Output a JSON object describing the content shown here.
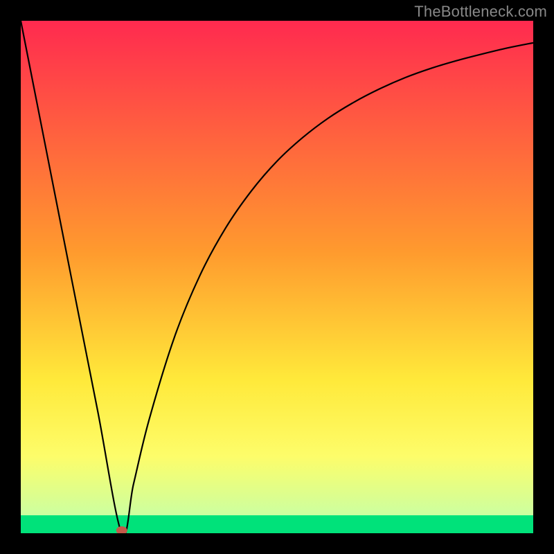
{
  "watermark": "TheBottleneck.com",
  "chart_data": {
    "type": "line",
    "title": "",
    "xlabel": "",
    "ylabel": "",
    "xlim": [
      0,
      100
    ],
    "ylim": [
      0,
      100
    ],
    "grid": false,
    "series": [
      {
        "name": "curve",
        "x": [
          0,
          5,
          10,
          15,
          19.7,
          22,
          25,
          30,
          35,
          40,
          45,
          50,
          55,
          60,
          65,
          70,
          75,
          80,
          85,
          90,
          95,
          100
        ],
        "y": [
          100,
          74.6,
          49.2,
          23.9,
          0,
          9.6,
          22.0,
          38.3,
          50.4,
          59.6,
          66.8,
          72.6,
          77.2,
          81.0,
          84.1,
          86.7,
          88.9,
          90.7,
          92.2,
          93.5,
          94.7,
          95.7
        ]
      }
    ],
    "bottom_band": {
      "from_y": 0,
      "to_y": 3.5,
      "color": "#00e27a"
    },
    "marker": {
      "x": 19.7,
      "y": 0,
      "color": "#c55a4a"
    },
    "gradient_stops": [
      {
        "offset": 0,
        "color": "#ff2a4f"
      },
      {
        "offset": 45,
        "color": "#ff9a2e"
      },
      {
        "offset": 70,
        "color": "#ffe93a"
      },
      {
        "offset": 85,
        "color": "#fdfd6a"
      },
      {
        "offset": 96.5,
        "color": "#ccffa0"
      },
      {
        "offset": 100,
        "color": "#00e27a"
      }
    ]
  }
}
